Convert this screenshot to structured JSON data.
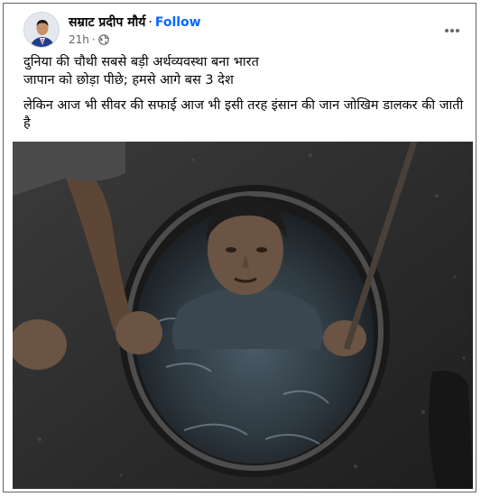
{
  "post": {
    "author": "सम्राट प्रदीप मौर्य",
    "separator": "·",
    "follow_label": "Follow",
    "time": "21h",
    "meta_separator": "·",
    "audience_icon": "globe-icon",
    "more_icon": "more-options-icon",
    "lines": [
      "दुनिया की चौथी सबसे बड़ी अर्थव्यवस्था बना भारत",
      "जापान को छोड़ा पीछे; हमसे आगे बस 3 देश",
      " लेकिन आज भी सीवर की सफाई आज भी इसी तरह इंसान की जान जोखिम डालकर की जाती है"
    ]
  },
  "colors": {
    "follow": "#0866ff",
    "text": "#050505",
    "meta": "#65676b",
    "frame_border": "#5f6368"
  }
}
